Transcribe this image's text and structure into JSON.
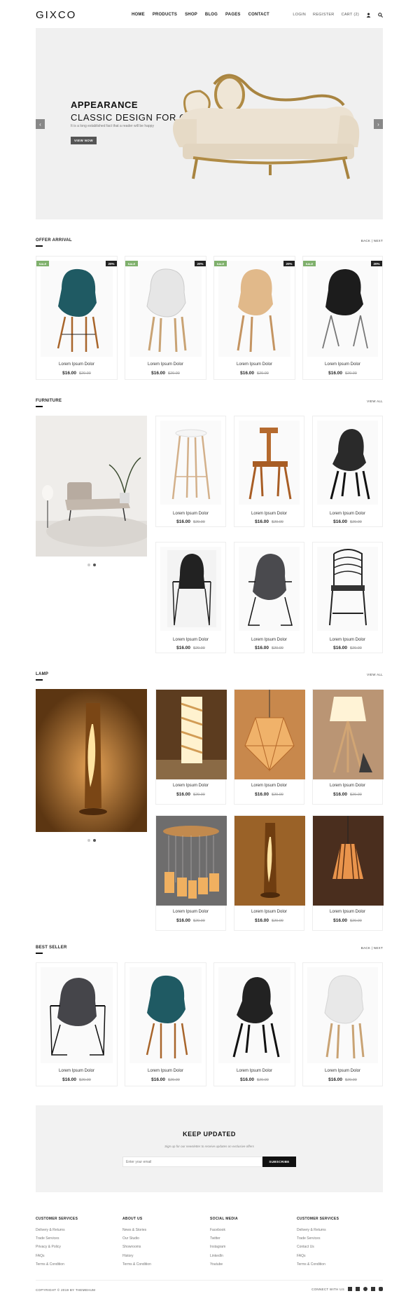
{
  "header": {
    "logo": "GIXCO",
    "nav": [
      "HOME",
      "PRODUCTS",
      "SHOP",
      "BLOG",
      "PAGES",
      "CONTACT"
    ],
    "login": "LOGIN",
    "register": "REGISTER",
    "cart": "CART (2)"
  },
  "hero": {
    "title": "APPEARANCE",
    "subtitle": "CLASSIC DESIGN FOR OFFICE",
    "text": "It is a long established fact that a reader will be happy",
    "button": "VIEW NOW",
    "prev_icon": "‹",
    "next_icon": "›"
  },
  "offer": {
    "title": "OFFER ARRIVAL",
    "nav": "BACK  |  NEXT",
    "items": [
      {
        "name": "Lorem Ipsum Dolor",
        "price": "$16.00",
        "old": "$20.00",
        "sale": "SALE",
        "discount": "20%"
      },
      {
        "name": "Lorem Ipsum Dolor",
        "price": "$16.00",
        "old": "$20.00",
        "sale": "SALE",
        "discount": "20%"
      },
      {
        "name": "Lorem Ipsum Dolor",
        "price": "$16.00",
        "old": "$20.00",
        "sale": "SALE",
        "discount": "20%"
      },
      {
        "name": "Lorem Ipsum Dolor",
        "price": "$16.00",
        "old": "$20.00",
        "sale": "SALE",
        "discount": "20%"
      }
    ]
  },
  "furniture": {
    "title": "FURNITURE",
    "view_all": "VIEW ALL",
    "items": [
      {
        "name": "Lorem Ipsum Dolor",
        "price": "$16.00",
        "old": "$20.00"
      },
      {
        "name": "Lorem Ipsum Dolor",
        "price": "$16.00",
        "old": "$20.00"
      },
      {
        "name": "Lorem Ipsum Dolor",
        "price": "$16.00",
        "old": "$20.00"
      },
      {
        "name": "Lorem Ipsum Dolor",
        "price": "$16.00",
        "old": "$20.00"
      },
      {
        "name": "Lorem Ipsum Dolor",
        "price": "$16.00",
        "old": "$20.00"
      },
      {
        "name": "Lorem Ipsum Dolor",
        "price": "$16.00",
        "old": "$20.00"
      }
    ]
  },
  "lamp": {
    "title": "LAMP",
    "view_all": "VIEW ALL",
    "items": [
      {
        "name": "Lorem Ipsum Dolor",
        "price": "$16.00",
        "old": "$20.00"
      },
      {
        "name": "Lorem Ipsum Dolor",
        "price": "$16.00",
        "old": "$20.00"
      },
      {
        "name": "Lorem Ipsum Dolor",
        "price": "$16.00",
        "old": "$20.00"
      },
      {
        "name": "Lorem Ipsum Dolor",
        "price": "$16.00",
        "old": "$20.00"
      },
      {
        "name": "Lorem Ipsum Dolor",
        "price": "$16.00",
        "old": "$20.00"
      },
      {
        "name": "Lorem Ipsum Dolor",
        "price": "$16.00",
        "old": "$20.00"
      }
    ]
  },
  "best": {
    "title": "BEST SELLER",
    "nav": "BACK  |  NEXT",
    "items": [
      {
        "name": "Lorem Ipsum Dolor",
        "price": "$16.00",
        "old": "$20.00"
      },
      {
        "name": "Lorem Ipsum Dolor",
        "price": "$16.00",
        "old": "$20.00"
      },
      {
        "name": "Lorem Ipsum Dolor",
        "price": "$16.00",
        "old": "$20.00"
      },
      {
        "name": "Lorem Ipsum Dolor",
        "price": "$16.00",
        "old": "$20.00"
      }
    ]
  },
  "newsletter": {
    "title": "KEEP UPDATED",
    "text": "Sign up for our newsletter to receive updates on exclusive offers",
    "placeholder": "Enter your email",
    "button": "SUBSCRIBE"
  },
  "footer": {
    "columns": [
      {
        "title": "CUSTOMER SERVICES",
        "items": [
          "Delivery & Returns",
          "Trade Services",
          "Privacy & Policy",
          "FAQs",
          "Terms & Condition"
        ]
      },
      {
        "title": "ABOUT US",
        "items": [
          "News & Stories",
          "Our Studio",
          "Showrooms",
          "History",
          "Terms & Condition"
        ]
      },
      {
        "title": "SOCIAL MEDIA",
        "items": [
          "Facebook",
          "Twitter",
          "Instagram",
          "LinkedIn",
          "Youtube"
        ]
      },
      {
        "title": "CUSTOMER SERVICES",
        "items": [
          "Delivery & Returns",
          "Trade Services",
          "Contact Us",
          "FAQs",
          "Terms & Condition"
        ]
      }
    ],
    "copyright": "COPYRIGHT © 2019 BY THEMEHUM",
    "connect": "CONNECT WITH US",
    "social_icons": [
      "facebook-icon",
      "twitter-icon",
      "pinterest-icon",
      "youtube-icon",
      "instagram-icon"
    ]
  }
}
